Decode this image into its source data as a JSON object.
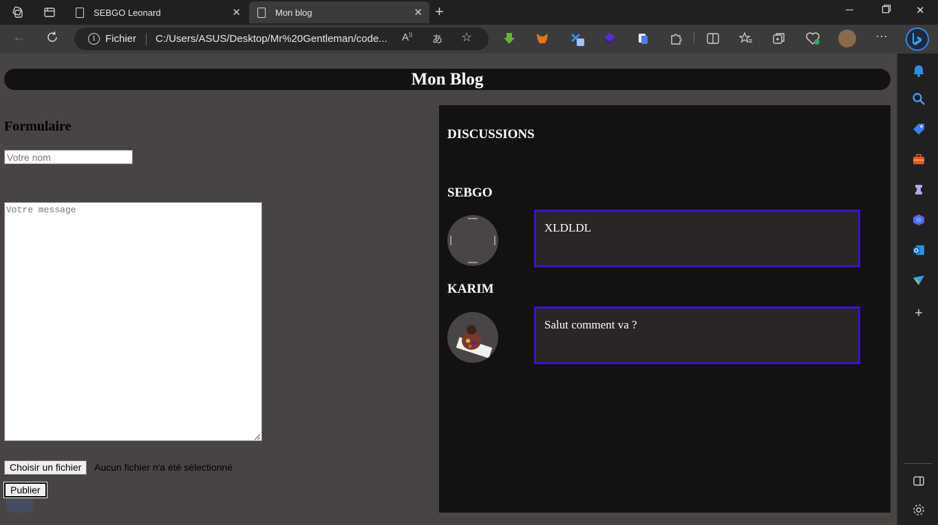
{
  "browser": {
    "tabs": [
      {
        "title": "SEBGO Leonard",
        "active": false
      },
      {
        "title": "Mon blog",
        "active": true
      }
    ],
    "address": {
      "scheme_label": "Fichier",
      "url": "C:/Users/ASUS/Desktop/Mr%20Gentleman/code..."
    }
  },
  "page": {
    "header": "Mon Blog",
    "form": {
      "title": "Formulaire",
      "name_placeholder": "Votre nom",
      "message_placeholder": "Votre message",
      "file_button": "Choisir un fichier",
      "file_status": "Aucun fichier n'a été sélectionné",
      "publish_button": "Publier"
    },
    "discussions": {
      "title": "DISCUSSIONS",
      "posts": [
        {
          "author": "SEBGO",
          "message": "XLDLDL"
        },
        {
          "author": "KARIM",
          "message": "Salut comment va ?"
        }
      ]
    }
  },
  "colors": {
    "accent_border": "#3c12d2",
    "panel_bg": "#131112",
    "page_bg": "#494443"
  }
}
